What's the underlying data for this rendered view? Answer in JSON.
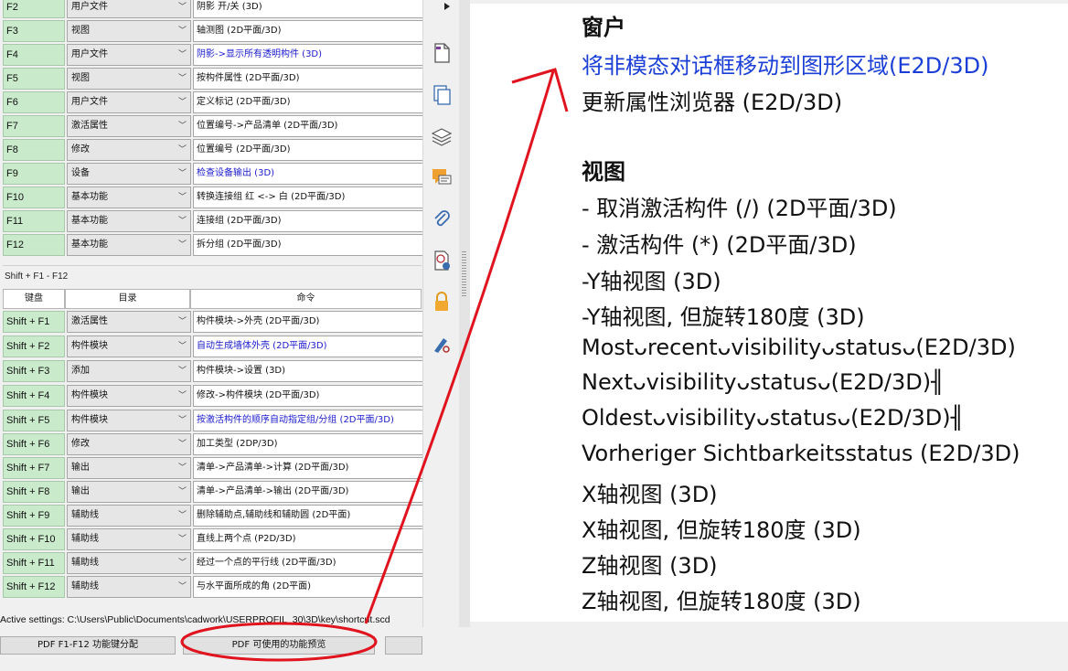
{
  "top_table": {
    "rows": [
      {
        "key": "F2",
        "category": "用户文件",
        "command": "阴影 开/关 (3D)",
        "blue": false
      },
      {
        "key": "F3",
        "category": "视图",
        "command": "轴测图 (2D平面/3D)",
        "blue": false
      },
      {
        "key": "F4",
        "category": "用户文件",
        "command": "阴影->显示所有透明构件 (3D)",
        "blue": true
      },
      {
        "key": "F5",
        "category": "视图",
        "command": "按构件属性 (2D平面/3D)",
        "blue": false
      },
      {
        "key": "F6",
        "category": "用户文件",
        "command": "定义标记 (2D平面/3D)",
        "blue": false
      },
      {
        "key": "F7",
        "category": "激活属性",
        "command": "位置编号->产品清单 (2D平面/3D)",
        "blue": false
      },
      {
        "key": "F8",
        "category": "修改",
        "command": "位置编号 (2D平面/3D)",
        "blue": false
      },
      {
        "key": "F9",
        "category": "设备",
        "command": "检查设备输出 (3D)",
        "blue": true
      },
      {
        "key": "F10",
        "category": "基本功能",
        "command": "转换连接组 红 <-> 白 (2D平面/3D)",
        "blue": false
      },
      {
        "key": "F11",
        "category": "基本功能",
        "command": "连接组 (2D平面/3D)",
        "blue": false
      },
      {
        "key": "F12",
        "category": "基本功能",
        "command": "拆分组 (2D平面/3D)",
        "blue": false
      }
    ]
  },
  "shift_section": {
    "title": "Shift + F1 - F12",
    "headers": {
      "key": "键盘",
      "category": "目录",
      "command": "命令"
    },
    "rows": [
      {
        "key": "Shift + F1",
        "category": "激活属性",
        "command": "构件模块->外壳 (2D平面/3D)",
        "blue": false
      },
      {
        "key": "Shift + F2",
        "category": "构件模块",
        "command": "自动生成墙体外壳 (2D平面/3D)",
        "blue": true
      },
      {
        "key": "Shift + F3",
        "category": "添加",
        "command": "构件模块->设置 (3D)",
        "blue": false
      },
      {
        "key": "Shift + F4",
        "category": "构件模块",
        "command": "修改->构件模块 (2D平面/3D)",
        "blue": false
      },
      {
        "key": "Shift + F5",
        "category": "构件模块",
        "command": "按激活构件的顺序自动指定组/分组 (2D平面/3D)",
        "blue": true
      },
      {
        "key": "Shift + F6",
        "category": "修改",
        "command": "加工类型 (2DP/3D)",
        "blue": false
      },
      {
        "key": "Shift + F7",
        "category": "输出",
        "command": "清单->产品清单->计算 (2D平面/3D)",
        "blue": false
      },
      {
        "key": "Shift + F8",
        "category": "输出",
        "command": "清单->产品清单->输出 (2D平面/3D)",
        "blue": false
      },
      {
        "key": "Shift + F9",
        "category": "辅助线",
        "command": "删除辅助点,辅助线和辅助圆 (2D平面)",
        "blue": false
      },
      {
        "key": "Shift + F10",
        "category": "辅助线",
        "command": "直线上两个点 (P2D/3D)",
        "blue": false
      },
      {
        "key": "Shift + F11",
        "category": "辅助线",
        "command": "经过一个点的平行线 (2D平面/3D)",
        "blue": false
      },
      {
        "key": "Shift + F12",
        "category": "辅助线",
        "command": "与水平面所成的角 (2D平面)",
        "blue": false
      }
    ]
  },
  "active_settings": "Active settings:  C:\\Users\\Public\\Documents\\cadwork\\USERPROFIL_30\\3D\\key\\shortcut.scd",
  "buttons": {
    "pdf_assignment": "PDF F1-F12 功能键分配",
    "pdf_preview": "PDF 可使用的功能预览"
  },
  "document": {
    "lines": [
      {
        "text": "窗户"
      },
      {
        "text": "将非模态对话框移动到图形区域(E2D/3D)"
      },
      {
        "text": "更新属性浏览器 (E2D/3D)"
      },
      {
        "text": "视图"
      },
      {
        "text": " - 取消激活构件 (/) (2D平面/3D)"
      },
      {
        "text": " - 激活构件 (*) (2D平面/3D)"
      },
      {
        "text": "-Y轴视图 (3D)"
      },
      {
        "text": "-Y轴视图, 但旋转180度 (3D)"
      },
      {
        "text": "Mostᴗrecentᴗvisibilityᴗstatusᴗ(E2D/3D)"
      },
      {
        "text": "Nextᴗvisibilityᴗstatusᴗ(E2D/3D)╢"
      },
      {
        "text": "Oldestᴗvisibilityᴗstatusᴗ(E2D/3D)╢"
      },
      {
        "text": "Vorheriger Sichtbarkeitsstatus (E2D/3D)"
      },
      {
        "text": "X轴视图  (3D)"
      },
      {
        "text": "X轴视图, 但旋转180度 (3D)"
      },
      {
        "text": "Z轴视图 (3D)"
      },
      {
        "text": "Z轴视图, 但旋转180度 (3D)"
      }
    ]
  },
  "colors": {
    "key_bg": "#c9eacb",
    "blue_text": "#1a1acc",
    "doc_blue": "#1b3fd6",
    "annotation": "#e0141e"
  },
  "icons": [
    "page-icon",
    "copy-icon",
    "layers-icon",
    "comment-icon",
    "attachment-icon",
    "certificate-icon",
    "lock-icon",
    "sign-icon"
  ]
}
